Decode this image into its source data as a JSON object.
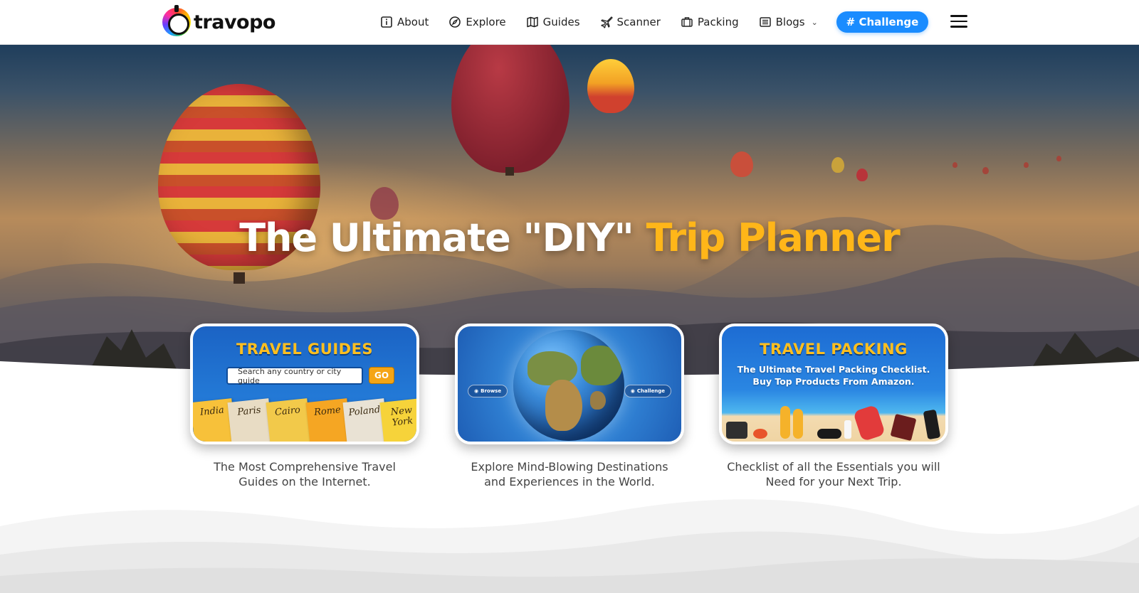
{
  "brand": {
    "name": "travopo"
  },
  "nav": {
    "items": [
      {
        "label": "About",
        "icon": "info-icon"
      },
      {
        "label": "Explore",
        "icon": "compass-icon"
      },
      {
        "label": "Guides",
        "icon": "map-icon"
      },
      {
        "label": "Scanner",
        "icon": "plane-icon"
      },
      {
        "label": "Packing",
        "icon": "luggage-icon"
      },
      {
        "label": "Blogs",
        "icon": "article-icon"
      }
    ],
    "challenge_label": "# Challenge",
    "menu_icon": "hamburger-icon"
  },
  "hero": {
    "title_main": "The Ultimate \"DIY\" ",
    "title_accent": "Trip Planner"
  },
  "cards": [
    {
      "title": "TRAVEL GUIDES",
      "search_placeholder": "Search any country or city guide",
      "go_label": "GO",
      "books": [
        "India",
        "Paris",
        "Cairo",
        "Rome",
        "Poland",
        "New York"
      ],
      "caption_line1": "The Most Comprehensive Travel",
      "caption_line2": "Guides on the Internet."
    },
    {
      "pill_left": "Browse",
      "pill_right": "Challenge",
      "caption_line1": "Explore Mind-Blowing Destinations",
      "caption_line2": "and Experiences in the World."
    },
    {
      "title": "TRAVEL PACKING",
      "subtitle_line1": "The Ultimate Travel Packing Checklist.",
      "subtitle_line2": "Buy Top Products From Amazon.",
      "caption_line1": "Checklist of all the Essentials you will",
      "caption_line2": "Need for your Next Trip."
    }
  ],
  "colors": {
    "accent": "#ffb619",
    "challenge_button": "#1a8cff",
    "card_blue": "#2379d6"
  }
}
